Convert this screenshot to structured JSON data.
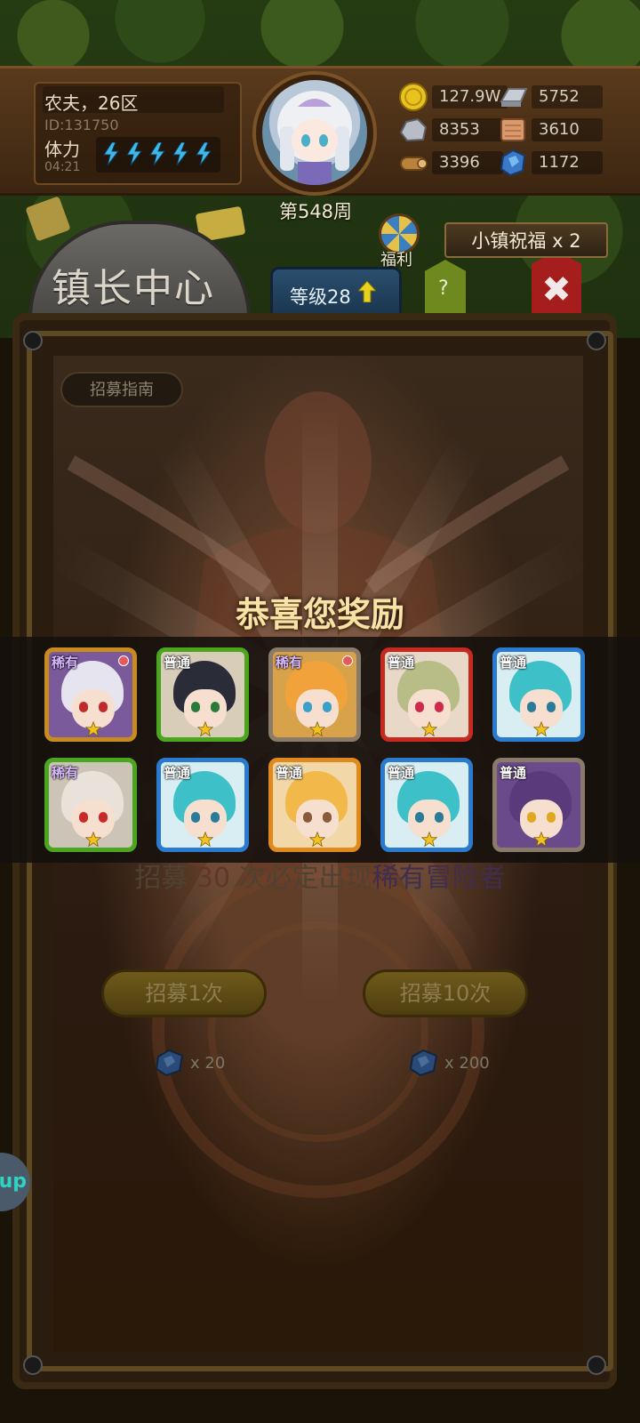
{
  "player": {
    "name_server": "农夫，26区",
    "id": "ID:131750",
    "stamina_label": "体力",
    "stamina_timer": "04:21",
    "stamina_filled": 5,
    "stamina_total": 5
  },
  "week_label": "第548周",
  "resources": {
    "gold": "127.9W",
    "iron": "5752",
    "stone": "8353",
    "cloth": "3610",
    "wood": "3396",
    "crystal": "1172"
  },
  "nav": {
    "hall_title": "镇长中心",
    "level": "等级28",
    "help": "?",
    "close": "✖",
    "welfare": "福利",
    "blessing": "小镇祝福 x 2"
  },
  "recruit": {
    "guide_button": "招募指南",
    "pity_prefix": "招募",
    "pity_count": "30",
    "pity_middle": "次必定出现",
    "pity_rarity": "稀有冒险者",
    "once_label": "招募1次",
    "once_cost": "x 20",
    "ten_label": "招募10次",
    "ten_cost": "x 200"
  },
  "reward": {
    "title": "恭喜您奖励",
    "cards": [
      {
        "rarity": "稀有",
        "border": "#c98a1e",
        "bg": "#7a5a9a",
        "hair": "#e6e4ee",
        "eye": "#c02a2a",
        "badge": true
      },
      {
        "rarity": "普通",
        "border": "#4ba51f",
        "bg": "#d8cdb8",
        "hair": "#2a2c38",
        "eye": "#2a7a3a",
        "badge": false
      },
      {
        "rarity": "稀有",
        "border": "#8a7a6a",
        "bg": "#d8a24a",
        "hair": "#f2a23a",
        "eye": "#3aa0c8",
        "badge": true
      },
      {
        "rarity": "普通",
        "border": "#c8291f",
        "bg": "#e8d8c8",
        "hair": "#b8bc86",
        "eye": "#d02a4a",
        "badge": false
      },
      {
        "rarity": "普通",
        "border": "#2a7ad0",
        "bg": "#d8eef2",
        "hair": "#3ec0c8",
        "eye": "#2a7a9a",
        "badge": false
      },
      {
        "rarity": "稀有",
        "border": "#4ba51f",
        "bg": "#ccc4b6",
        "hair": "#e8e2da",
        "eye": "#c82a2a",
        "badge": false
      },
      {
        "rarity": "普通",
        "border": "#2a7ad0",
        "bg": "#d8eef2",
        "hair": "#3ec0c8",
        "eye": "#2a7a9a",
        "badge": false
      },
      {
        "rarity": "普通",
        "border": "#e08a1e",
        "bg": "#f2d8a8",
        "hair": "#f2b84a",
        "eye": "#8a5a3a",
        "badge": false
      },
      {
        "rarity": "普通",
        "border": "#2a7ad0",
        "bg": "#d8eef2",
        "hair": "#3ec0c8",
        "eye": "#2a7a9a",
        "badge": false
      },
      {
        "rarity": "普通",
        "border": "#8a7a6a",
        "bg": "#6a4a8a",
        "hair": "#5a3a7a",
        "eye": "#e0a81e",
        "badge": false
      }
    ]
  },
  "side_bubble": "up",
  "colors": {
    "bolt": "#3fb8e8",
    "star": "#f4c21e",
    "gold_coin": "#e8c21e",
    "crystal": "#3a78c8"
  }
}
